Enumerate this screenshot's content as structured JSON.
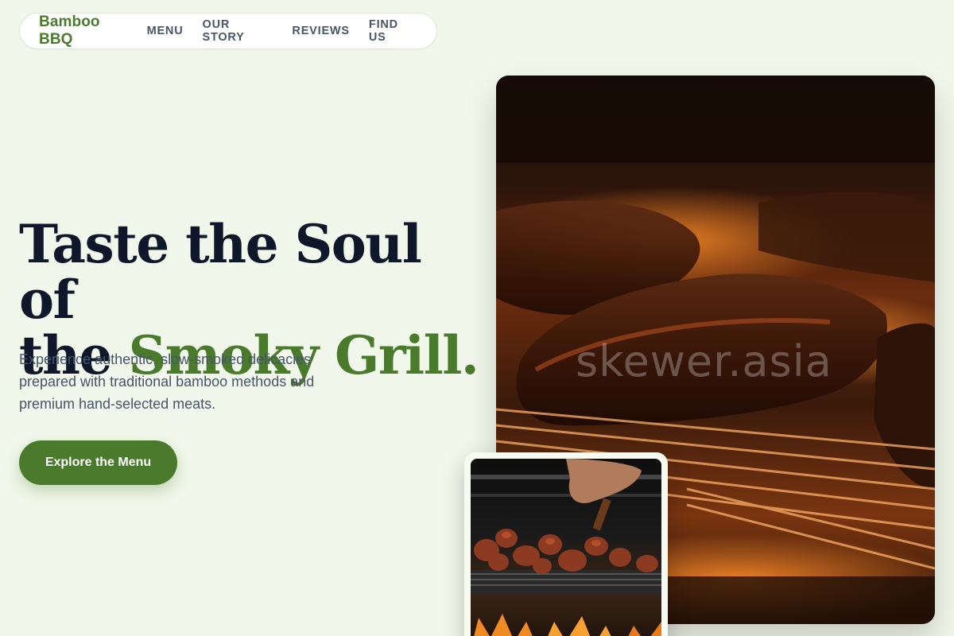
{
  "nav": {
    "brand": "Bamboo BBQ",
    "links": [
      "MENU",
      "OUR STORY",
      "REVIEWS",
      "FIND US"
    ]
  },
  "hero": {
    "title_line1": "Taste the Soul of",
    "title_line2_prefix": "the ",
    "title_accent": "Smoky Grill.",
    "subtitle": "Experience authentic, slow-smoked delicacies prepared with traditional bamboo methods and premium hand-selected meats.",
    "cta_label": "Explore the Menu"
  },
  "images": {
    "main_watermark": "skewer.asia"
  },
  "colors": {
    "background": "#f1f7ea",
    "accent": "#4a7a2c",
    "heading": "#0f172a",
    "body_text": "#475569"
  }
}
